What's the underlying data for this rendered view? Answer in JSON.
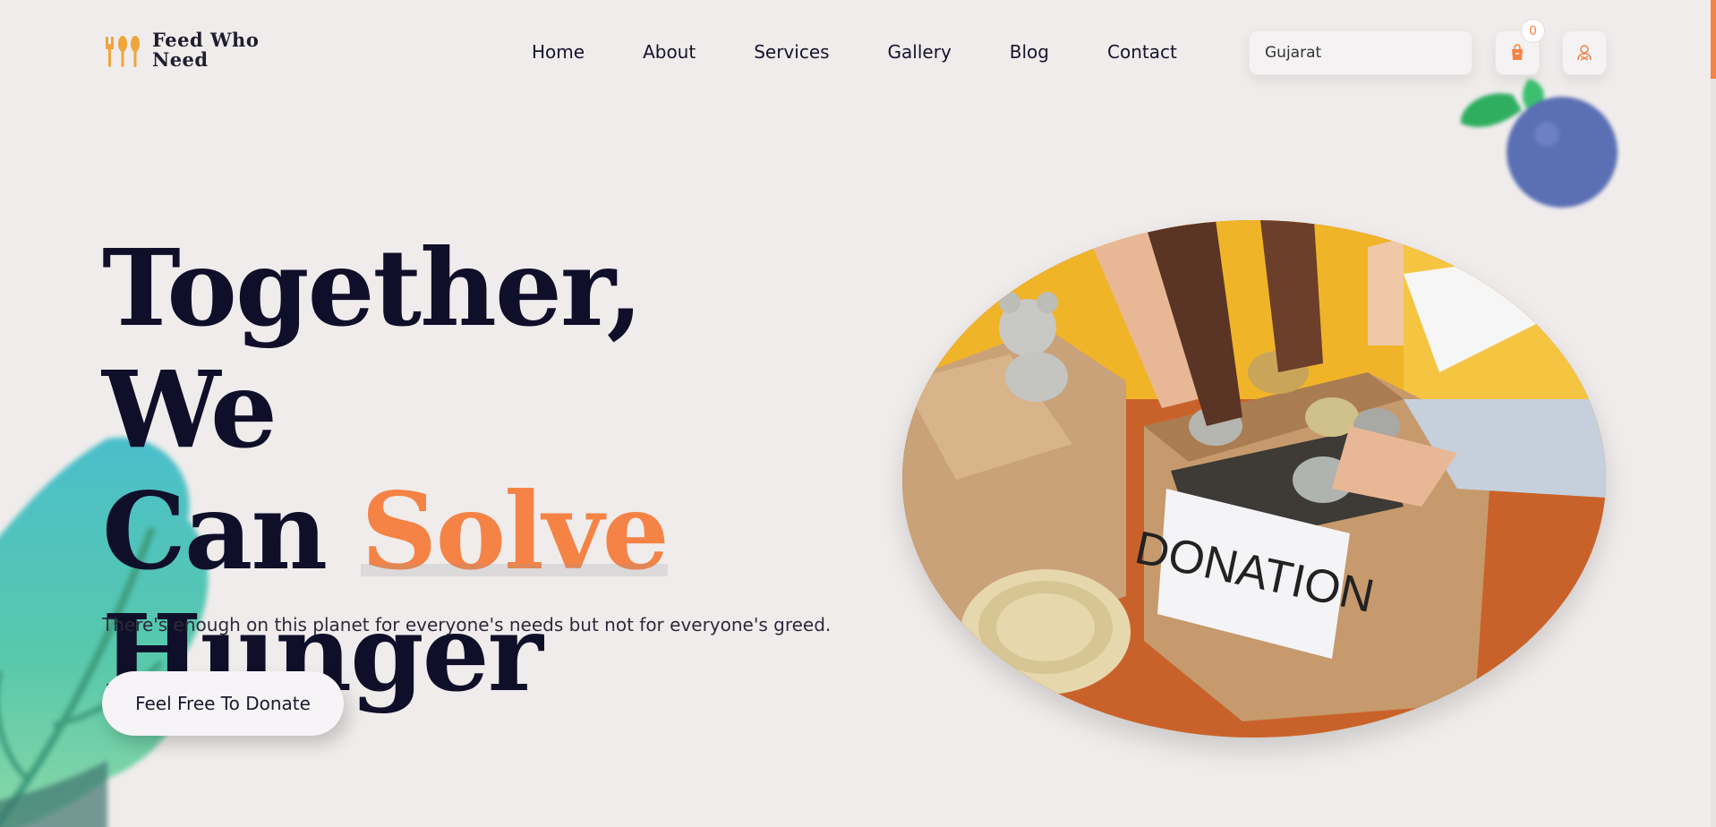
{
  "brand": {
    "line1": "Feed Who",
    "line2": "Need"
  },
  "nav": {
    "items": [
      {
        "label": "Home"
      },
      {
        "label": "About"
      },
      {
        "label": "Services"
      },
      {
        "label": "Gallery"
      },
      {
        "label": "Blog"
      },
      {
        "label": "Contact"
      }
    ]
  },
  "search": {
    "value": "Gujarat",
    "icon": "search-icon"
  },
  "cart": {
    "count": "0",
    "icon": "shopping-bag-icon"
  },
  "user": {
    "icon": "user-icon"
  },
  "hero": {
    "headline_line1": "Together, We",
    "headline_can": "Can",
    "headline_accent": "Solve",
    "headline_line3": "Hunger",
    "subtext": "There's enough on this planet for everyone's needs but not for everyone's greed.",
    "cta_label": "Feel Free To Donate",
    "photo_label": "DONATION"
  },
  "colors": {
    "accent": "#f58345",
    "background": "#f0ecec",
    "text_dark": "#0f0f2a"
  }
}
